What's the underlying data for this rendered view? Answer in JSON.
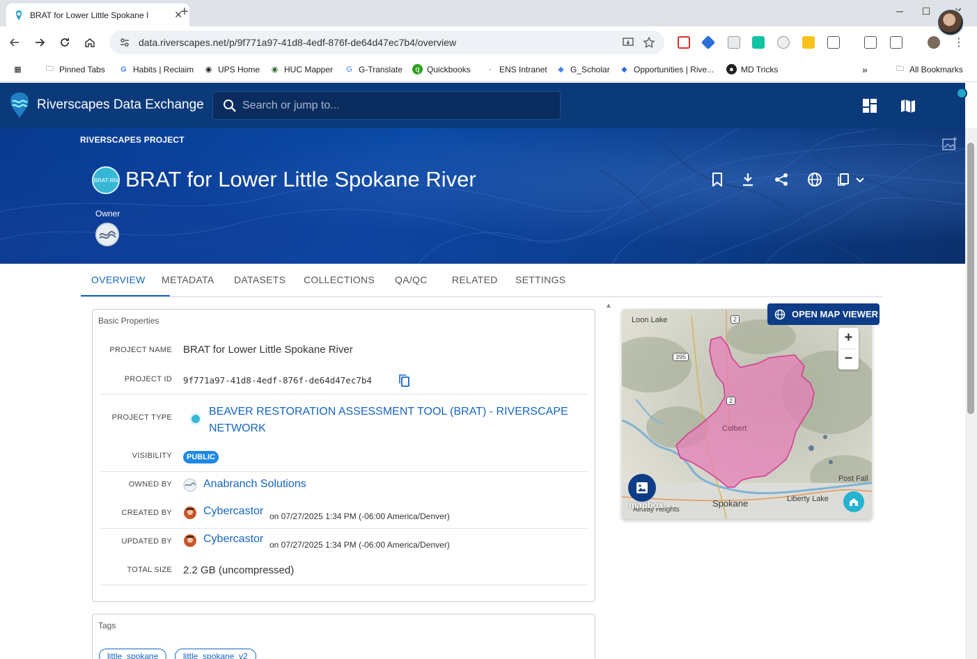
{
  "browser": {
    "tab_title": "BRAT for Lower Little Spokane I",
    "tab_close": "✕",
    "new_tab": "+",
    "url": "data.riverscapes.net/p/9f771a97-41d8-4edf-876f-de64d47ec7b4/overview",
    "bookmarks": [
      {
        "label": "Pinned Tabs",
        "icon": "folder-icon"
      },
      {
        "label": "Habits | Reclaim",
        "icon": "google-icon"
      },
      {
        "label": "UPS Home",
        "icon": "globe-icon"
      },
      {
        "label": "HUC Mapper",
        "icon": "globe-icon"
      },
      {
        "label": "G-Translate",
        "icon": "translate-icon"
      },
      {
        "label": "Quickbooks",
        "icon": "quickbooks-icon"
      },
      {
        "label": "ENS Intranet",
        "icon": "dot-icon"
      },
      {
        "label": "G_Scholar",
        "icon": "scholar-icon"
      },
      {
        "label": "Opportunities | Rive...",
        "icon": "riverscapes-icon"
      },
      {
        "label": "MD Tricks",
        "icon": "github-icon"
      }
    ],
    "bookmarks_overflow": "»",
    "all_bookmarks": "All Bookmarks"
  },
  "app": {
    "title": "Riverscapes Data Exchange",
    "search_placeholder": "Search or jump to..."
  },
  "hero": {
    "type_label": "RIVERSCAPES PROJECT",
    "badge_text": "BRAT-RN",
    "title": "BRAT for Lower Little Spokane River",
    "owner_label": "Owner"
  },
  "tabs": [
    "OVERVIEW",
    "METADATA",
    "DATASETS",
    "COLLECTIONS",
    "QA/QC",
    "RELATED",
    "SETTINGS"
  ],
  "basic_properties": {
    "title": "Basic Properties",
    "project_name_label": "PROJECT NAME",
    "project_name": "BRAT for Lower Little Spokane River",
    "project_id_label": "PROJECT ID",
    "project_id": "9f771a97-41d8-4edf-876f-de64d47ec7b4",
    "project_type_label": "PROJECT TYPE",
    "project_type_line1": "BEAVER RESTORATION ASSESSMENT TOOL (BRAT) - RIVERSCAPE",
    "project_type_line2": "NETWORK",
    "visibility_label": "VISIBILITY",
    "visibility": "PUBLIC",
    "owned_by_label": "OWNED BY",
    "owned_by": "Anabranch Solutions",
    "created_by_label": "CREATED BY",
    "created_by": "Cybercastor",
    "created_on": "on 07/27/2025 1:34 PM (-06:00 America/Denver)",
    "updated_by_label": "UPDATED BY",
    "updated_by": "Cybercastor",
    "updated_on": "on 07/27/2025 1:34 PM (-06:00 America/Denver)",
    "total_size_label": "TOTAL SIZE",
    "total_size": "2.2 GB (uncompressed)"
  },
  "tags": {
    "title": "Tags",
    "items": [
      "little_spokane",
      "little_spokane_v2"
    ]
  },
  "map": {
    "open_viewer": "OPEN MAP VIEWER",
    "labels": {
      "loon_lake": "Loon Lake",
      "colbert": "Colbert",
      "spokane": "Spokane",
      "liberty_lake": "Liberty Lake",
      "post_falls": "Post Fall",
      "airway_heights": "Airway Heights",
      "route_2a": "2",
      "route_2b": "2",
      "route_395": "395"
    },
    "zoom_in": "+",
    "zoom_out": "−",
    "attribution": "mapbox",
    "watershed_color": "#e87bb8"
  }
}
